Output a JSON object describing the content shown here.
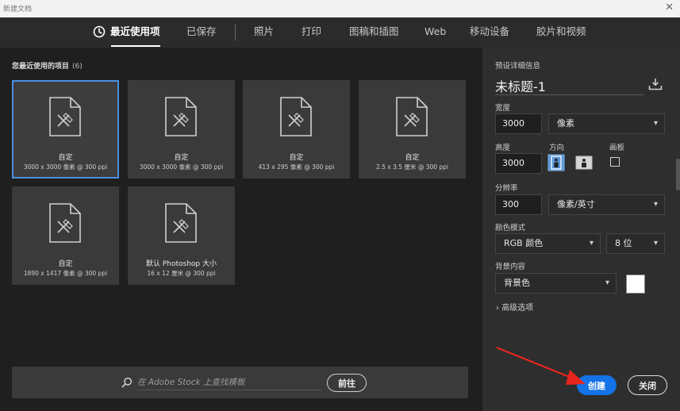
{
  "window": {
    "title": "新建文档",
    "close_glyph": "✕"
  },
  "tabs": [
    {
      "label": "最近使用项",
      "active": true,
      "icon": "clock-icon"
    },
    {
      "label": "已保存"
    },
    {
      "label": "照片"
    },
    {
      "label": "打印"
    },
    {
      "label": "图稿和插图"
    },
    {
      "label": "Web"
    },
    {
      "label": "移动设备"
    },
    {
      "label": "胶片和视频"
    }
  ],
  "recent": {
    "header": "您最近使用的项目",
    "count": "(6)",
    "items": [
      {
        "name": "自定",
        "dims": "3000 x 3000 像素 @ 300 ppi",
        "selected": true
      },
      {
        "name": "自定",
        "dims": "3000 x 3000 像素 @ 300 ppi"
      },
      {
        "name": "自定",
        "dims": "413 x 295 像素 @ 300 ppi"
      },
      {
        "name": "自定",
        "dims": "2.5 x 3.5 厘米 @ 300 ppi"
      },
      {
        "name": "自定",
        "dims": "1890 x 1417 像素 @ 300 ppi"
      },
      {
        "name": "默认 Photoshop 大小",
        "dims": "16 x 12 厘米 @ 300 ppi"
      }
    ]
  },
  "stock": {
    "placeholder": "在 Adobe Stock 上查找模板",
    "go_label": "前往"
  },
  "details": {
    "header": "预设详细信息",
    "doc_name": "未标题-1",
    "width_label": "宽度",
    "width_value": "3000",
    "width_unit": "像素",
    "height_label": "高度",
    "height_value": "3000",
    "orientation_label": "方向",
    "artboard_label": "画板",
    "resolution_label": "分辨率",
    "resolution_value": "300",
    "resolution_unit": "像素/英寸",
    "color_mode_label": "颜色模式",
    "color_mode_value": "RGB 颜色",
    "bit_depth_value": "8 位",
    "background_label": "背景内容",
    "background_value": "背景色",
    "background_color": "#ffffff",
    "advanced_label": "高级选项",
    "advanced_chevron": "›"
  },
  "actions": {
    "create_label": "创建",
    "close_label": "关闭"
  },
  "colors": {
    "accent": "#1473e6",
    "annotation_arrow": "#e8251f"
  }
}
